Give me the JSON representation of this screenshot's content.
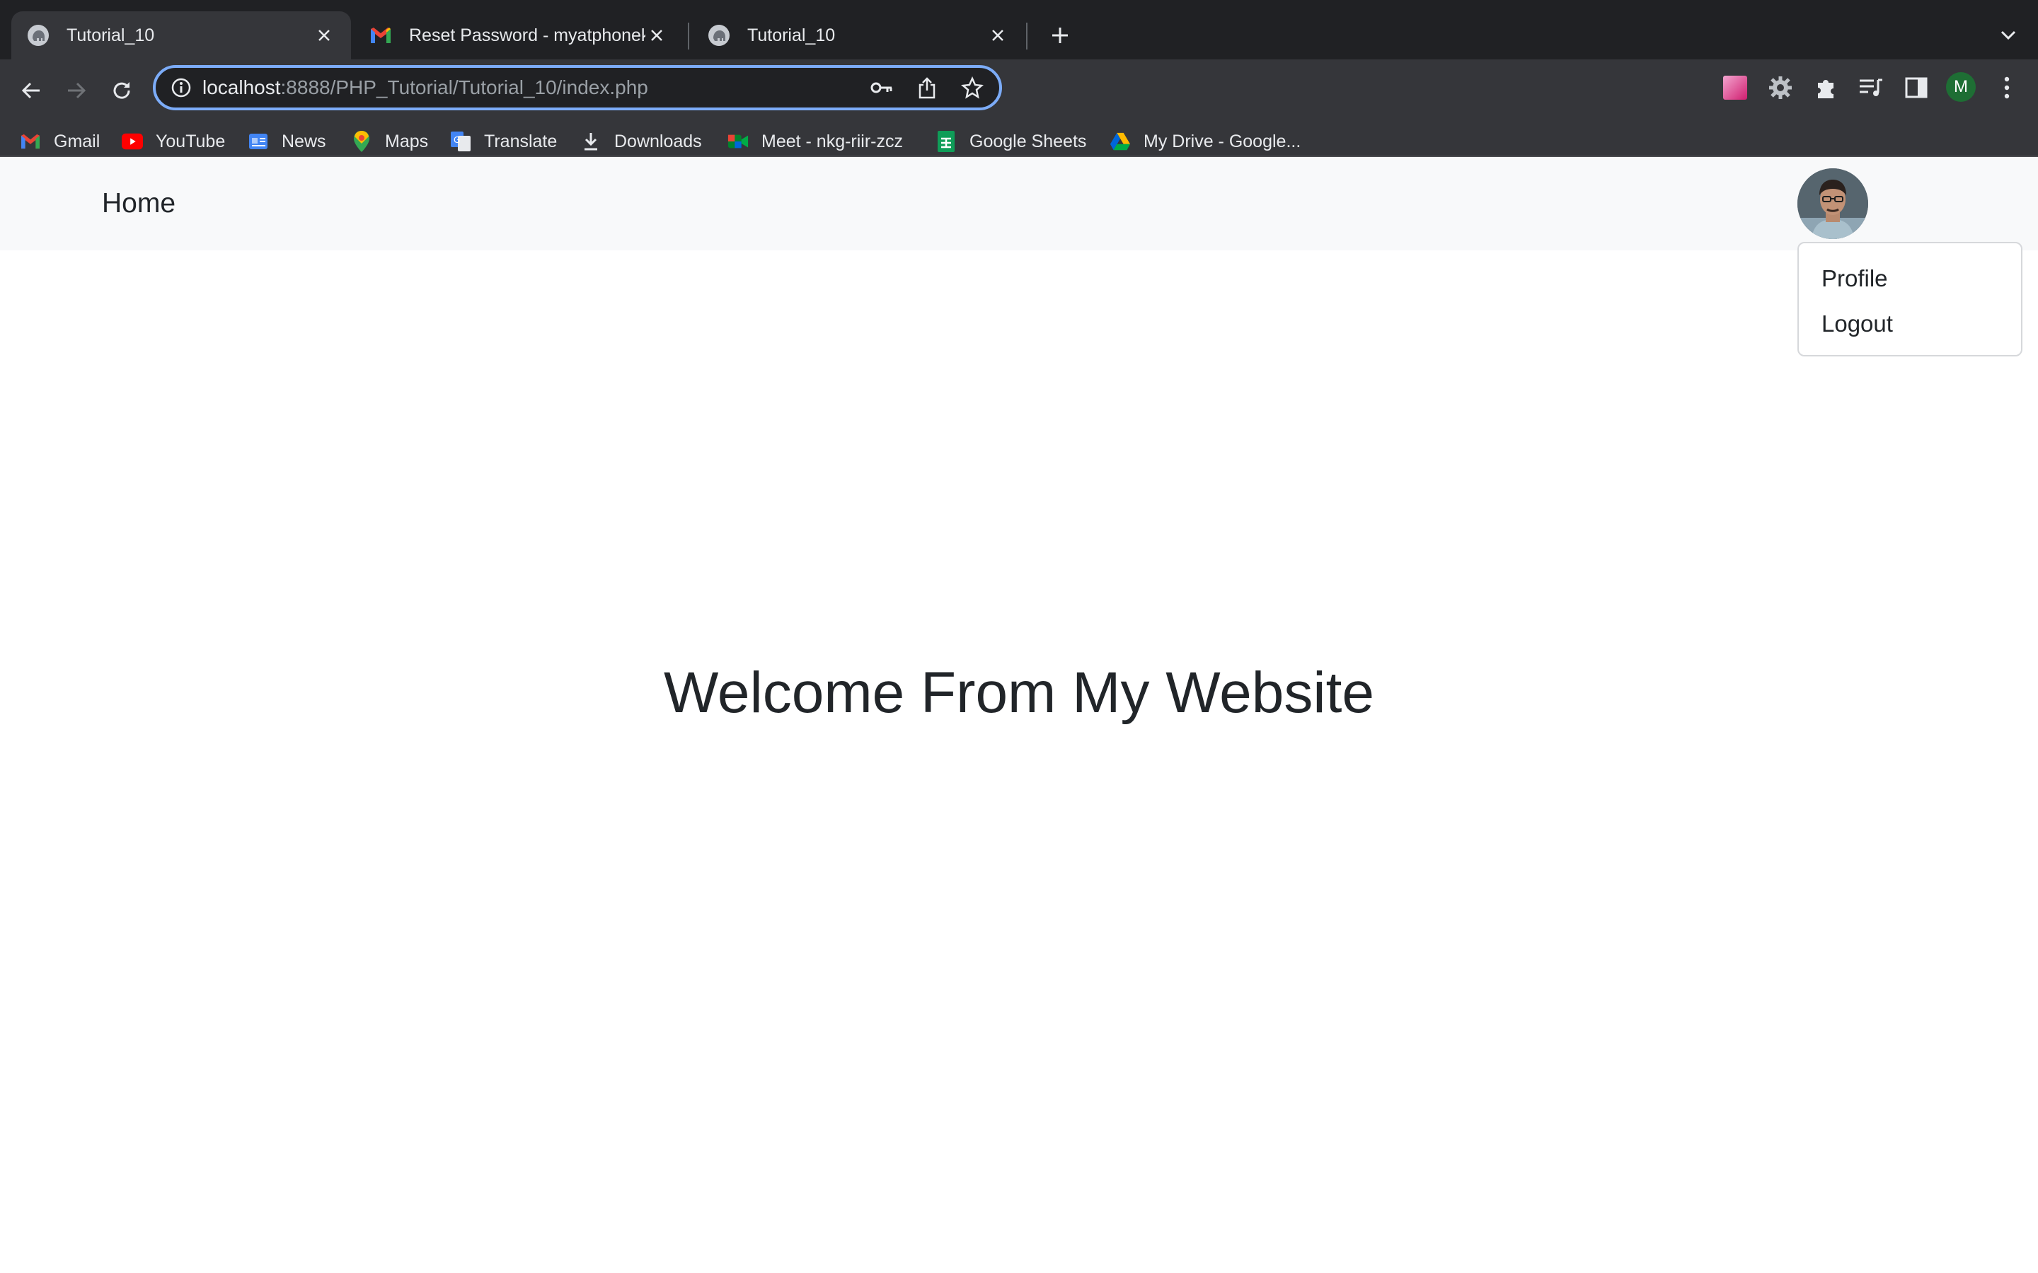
{
  "browser": {
    "tabs": [
      {
        "title": "Tutorial_10",
        "active": true,
        "favicon": "elephant-icon"
      },
      {
        "title": "Reset Password - myatphonek",
        "active": false,
        "favicon": "gmail-icon"
      },
      {
        "title": "Tutorial_10",
        "active": false,
        "favicon": "elephant-icon"
      }
    ],
    "address": {
      "host": "localhost",
      "path": ":8888/PHP_Tutorial/Tutorial_10/index.php"
    },
    "profile_initial": "M",
    "bookmarks": [
      {
        "label": "Gmail",
        "icon": "gmail-icon"
      },
      {
        "label": "YouTube",
        "icon": "youtube-icon"
      },
      {
        "label": "News",
        "icon": "news-icon"
      },
      {
        "label": "Maps",
        "icon": "maps-icon"
      },
      {
        "label": "Translate",
        "icon": "translate-icon"
      },
      {
        "label": "Downloads",
        "icon": "download-icon"
      },
      {
        "label": "Meet - nkg-riir-zcz",
        "icon": "meet-icon"
      },
      {
        "label": "Google Sheets",
        "icon": "sheets-icon"
      },
      {
        "label": "My Drive - Google...",
        "icon": "drive-icon"
      }
    ]
  },
  "page": {
    "nav": {
      "brand": "Home"
    },
    "user_menu": {
      "items": [
        "Profile",
        "Logout"
      ]
    },
    "heading": "Welcome From My Website"
  },
  "colors": {
    "chrome_dark": "#202124",
    "chrome_toolbar": "#35363a",
    "omnibox_focus": "#7cacf8",
    "navbar_bg": "#f8f9fa",
    "text_dark": "#212529"
  }
}
